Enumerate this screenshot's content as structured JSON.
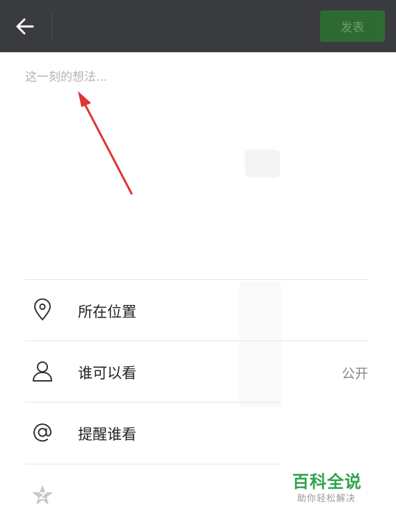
{
  "header": {
    "publish_label": "发表",
    "accent_color": "#2e6b33"
  },
  "compose": {
    "placeholder": "这一刻的想法..."
  },
  "options": {
    "location_label": "所在位置",
    "visibility_label": "谁可以看",
    "visibility_value": "公开",
    "mention_label": "提醒谁看"
  },
  "watermark": {
    "title": "百科全说",
    "subtitle": "助你轻松解决"
  },
  "icons": [
    "back-arrow-icon",
    "location-pin-icon",
    "person-icon",
    "at-icon",
    "star-icon"
  ]
}
